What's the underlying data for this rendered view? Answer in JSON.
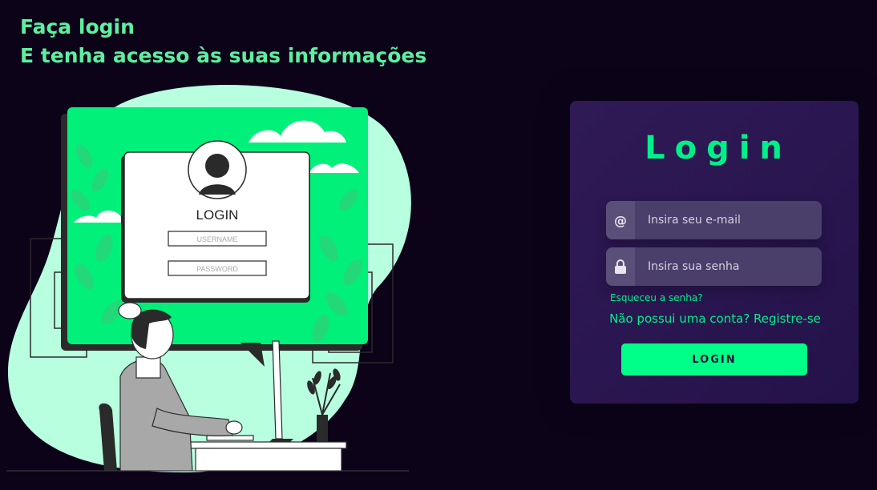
{
  "headline": {
    "line1": "Faça login",
    "line2": "E tenha acesso às suas informações"
  },
  "illustration": {
    "login_label": "LOGIN",
    "username_placeholder": "USERNAME",
    "password_placeholder": "PASSWORD"
  },
  "card": {
    "title": "Login",
    "email": {
      "icon": "at-icon",
      "placeholder": "Insira seu e-mail",
      "value": ""
    },
    "password": {
      "icon": "lock-icon",
      "placeholder": "Insira sua senha",
      "value": ""
    },
    "forgot_label": "Esqueceu a senha?",
    "register_label": "Não possui uma conta? Registre-se",
    "login_button": "LOGIN"
  },
  "colors": {
    "background": "#0c0319",
    "accent": "#00f088",
    "button": "#00ff88",
    "card": "#2a1650",
    "illustration_green": "#00f07a",
    "illustration_mint": "#b8ffe0"
  }
}
